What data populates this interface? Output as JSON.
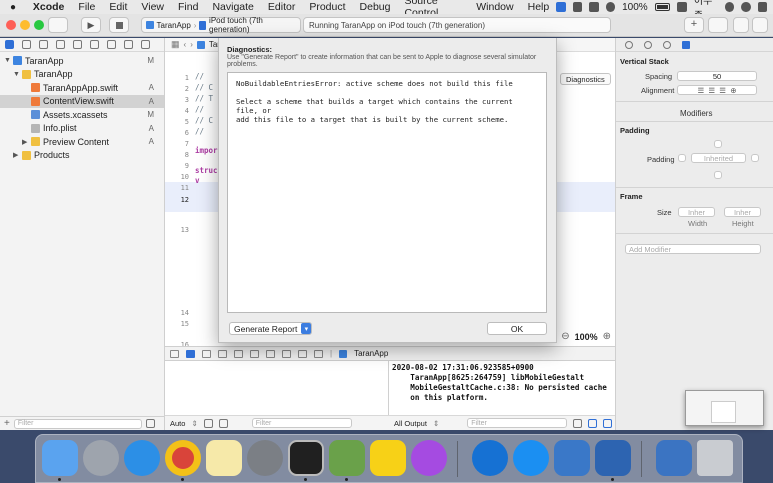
{
  "menubar": {
    "app_name": "Xcode",
    "items": [
      "File",
      "Edit",
      "View",
      "Find",
      "Navigate",
      "Editor",
      "Product",
      "Debug",
      "Source Control",
      "Window",
      "Help"
    ],
    "battery": "100%",
    "user": "이두종"
  },
  "toolbar": {
    "scheme": "TaranApp",
    "destination": "iPod touch (7th generation)",
    "activity": "Running TaranApp on iPod touch (7th generation)"
  },
  "navigator": {
    "items": [
      {
        "label": "TaranApp",
        "badge": "M"
      },
      {
        "label": "TaranApp",
        "badge": ""
      },
      {
        "label": "TaranAppApp.swift",
        "badge": "A"
      },
      {
        "label": "ContentView.swift",
        "badge": "A"
      },
      {
        "label": "Assets.xcassets",
        "badge": "M"
      },
      {
        "label": "Info.plist",
        "badge": "A"
      },
      {
        "label": "Preview Content",
        "badge": "A"
      },
      {
        "label": "Products",
        "badge": ""
      }
    ],
    "filter_placeholder": "Filter"
  },
  "editor": {
    "breadcrumb": "TaranApp",
    "line_numbers": [
      "1",
      "2",
      "3",
      "4",
      "5",
      "6",
      "7",
      "8",
      "9",
      "10",
      "11",
      "12",
      "13",
      "14",
      "15",
      "16"
    ],
    "code_fragments": [
      "//",
      "//  C",
      "//  T",
      "//",
      "//  C",
      "//",
      "",
      "impor",
      "",
      "struc",
      "    v",
      "",
      "",
      "",
      "",
      ""
    ],
    "zoom": "100%"
  },
  "debug": {
    "target": "TaranApp",
    "auto_label": "Auto",
    "output_label": "All Output",
    "filter_placeholder": "Filter",
    "console_text": "2020-08-02 17:31:06.923585+0900\n    TaranApp[8625:264759] libMobileGestalt\n    MobileGestaltCache.c:38: No persisted cache\n    on this platform."
  },
  "inspector": {
    "section_title": "Vertical Stack",
    "spacing_label": "Spacing",
    "spacing_value": "50",
    "alignment_label": "Alignment",
    "modifiers_title": "Modifiers",
    "padding_title": "Padding",
    "padding_label": "Padding",
    "padding_value": "Inherited",
    "frame_title": "Frame",
    "size_label": "Size",
    "width_value": "Inher",
    "height_value": "Inher",
    "width_label": "Width",
    "height_label": "Height",
    "add_modifier": "Add Modifier"
  },
  "diagnostics": {
    "title": "Diagnostics:",
    "subtitle": "Use \"Generate Report\" to create information that can be sent to Apple to diagnose several simulator problems.",
    "body": "NoBuildableEntriesError: active scheme does not build this file\n\nSelect a scheme that builds a target which contains the current file, or\nadd this file to a target that is built by the current scheme.",
    "generate_label": "Generate Report",
    "ok_label": "OK",
    "button_label": "Diagnostics"
  },
  "dock": {
    "apps": [
      "finder-icon",
      "launchpad-icon",
      "safari-icon",
      "chrome-icon",
      "notes-icon",
      "system-preferences-icon",
      "terminal-icon",
      "instruments-icon",
      "kakaotalk-icon",
      "podcasts-icon",
      "teamviewer-icon",
      "app-store-icon",
      "xcode-icon",
      "xcode-beta-icon",
      "xcode-downloads-icon",
      "trash-icon"
    ]
  }
}
